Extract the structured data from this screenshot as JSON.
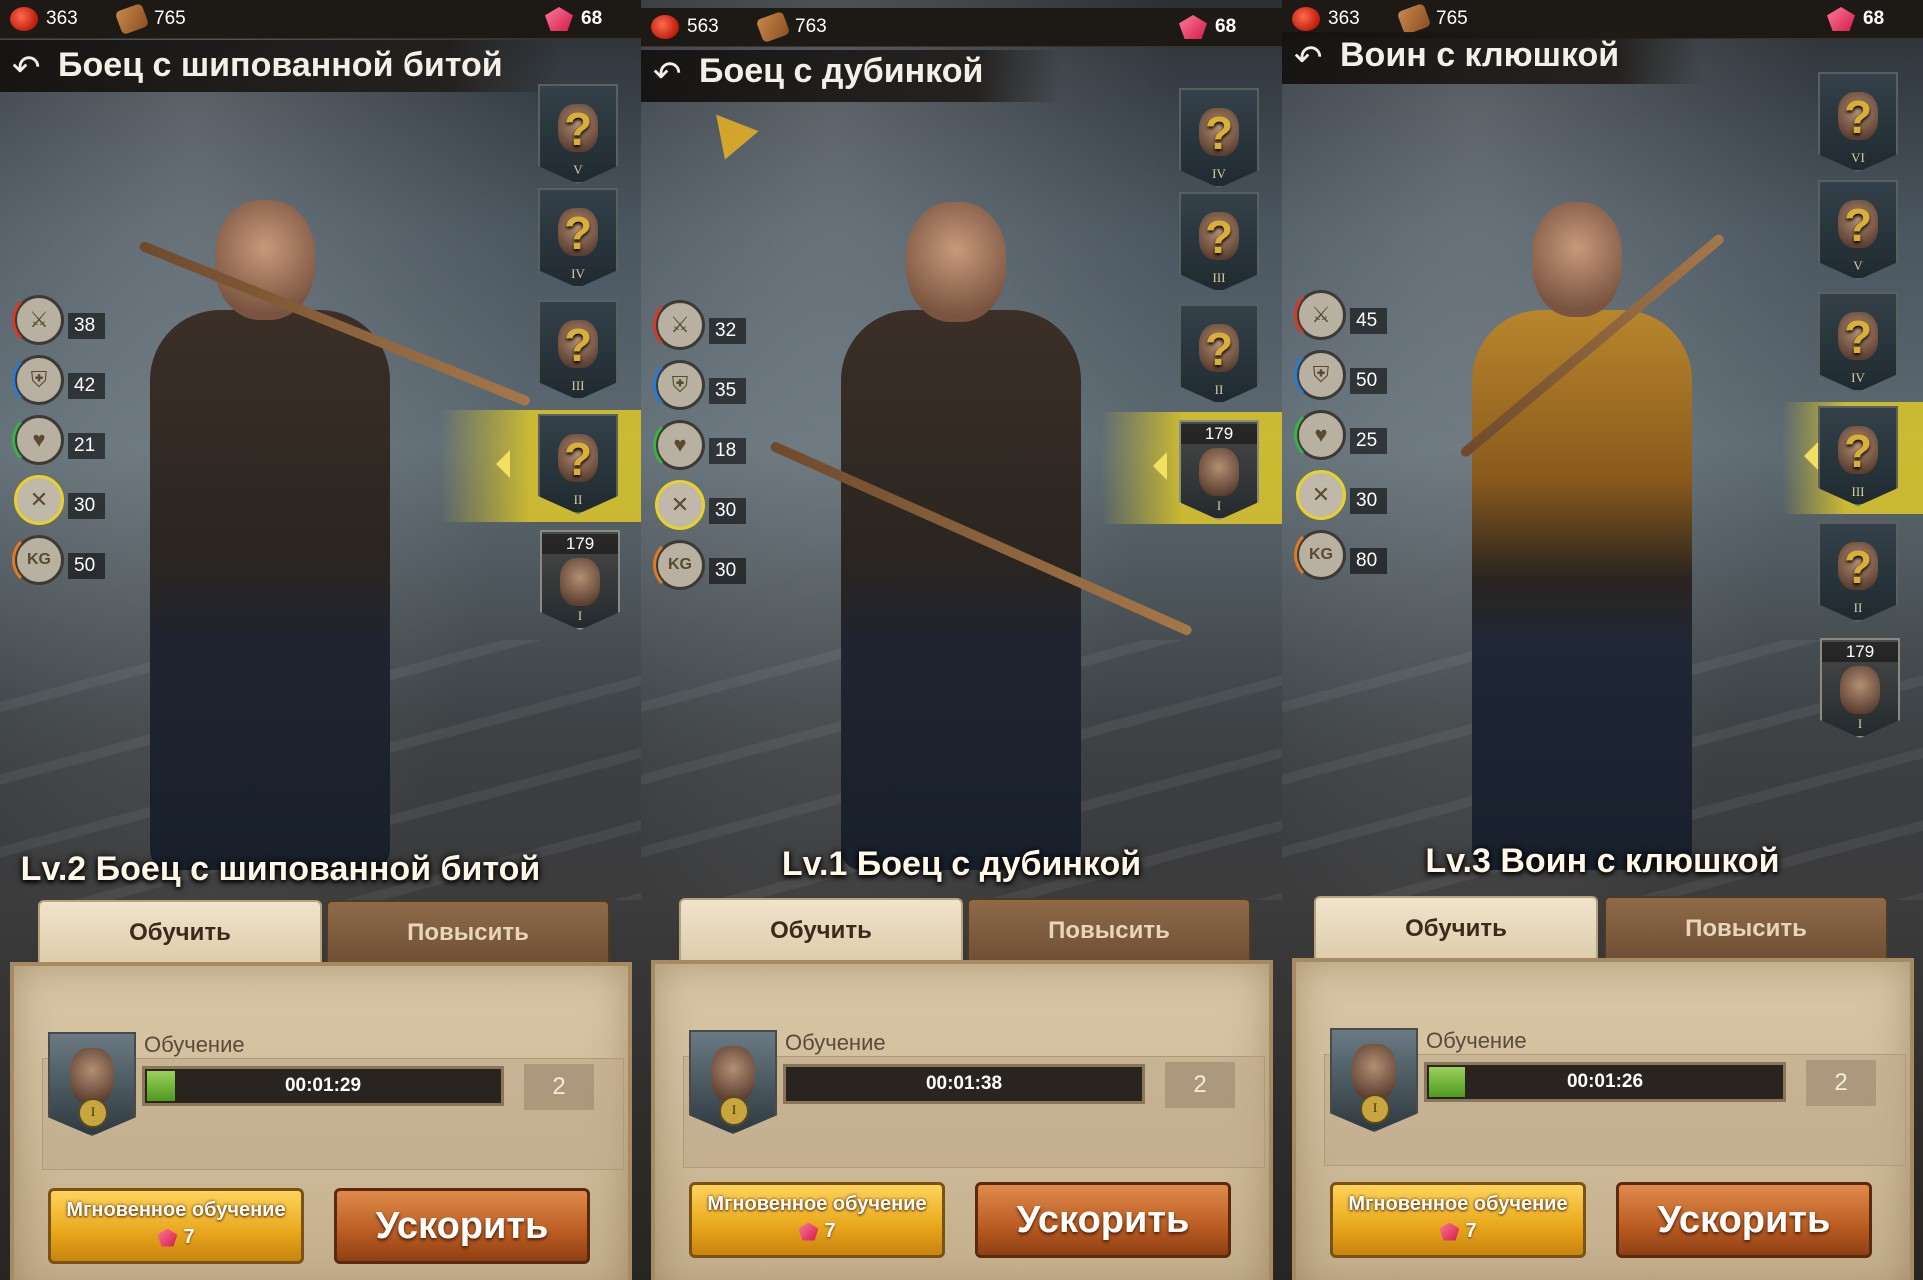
{
  "colors": {
    "accent_gold": "#d9b036",
    "selection": "#dec828",
    "progress_green": "#7cc040",
    "button_orange": "#b95c22",
    "button_yellow": "#e7a61c"
  },
  "panels": [
    {
      "resources": {
        "tomato": "363",
        "wood": "765",
        "gems": "68"
      },
      "title": "Боец с шипованной битой",
      "level_title": "Lv.2 Боец с шипованной битой",
      "stats": [
        {
          "icon": "attack-icon",
          "value": "38"
        },
        {
          "icon": "defense-icon",
          "value": "42"
        },
        {
          "icon": "health-icon",
          "value": "21"
        },
        {
          "icon": "power-icon",
          "value": "30"
        },
        {
          "icon": "load-kg-icon",
          "value": "50"
        }
      ],
      "roster": [
        {
          "tier": "V",
          "locked": true,
          "label": "?"
        },
        {
          "tier": "IV",
          "locked": true,
          "label": "?"
        },
        {
          "tier": "III",
          "locked": true,
          "label": "?"
        },
        {
          "tier": "II",
          "locked": true,
          "label": "?",
          "selected": true
        },
        {
          "tier": "I",
          "locked": false,
          "count": "179"
        }
      ],
      "tabs": {
        "train": "Обучить",
        "upgrade": "Повысить"
      },
      "training": {
        "label": "Обучение",
        "time": "00:01:29",
        "count": "2",
        "progress": 0.08,
        "tier": "I"
      },
      "buttons": {
        "instant": "Мгновенное обучение",
        "instant_cost": "7",
        "speed": "Ускорить"
      }
    },
    {
      "resources": {
        "tomato": "563",
        "wood": "763",
        "gems": "68"
      },
      "title": "Боец с дубинкой",
      "level_title": "Lv.1 Боец с дубинкой",
      "stats": [
        {
          "icon": "attack-icon",
          "value": "32"
        },
        {
          "icon": "defense-icon",
          "value": "35"
        },
        {
          "icon": "health-icon",
          "value": "18"
        },
        {
          "icon": "power-icon",
          "value": "30"
        },
        {
          "icon": "load-kg-icon",
          "value": "30"
        }
      ],
      "roster": [
        {
          "tier": "IV",
          "locked": true,
          "label": "?"
        },
        {
          "tier": "III",
          "locked": true,
          "label": "?"
        },
        {
          "tier": "II",
          "locked": true,
          "label": "?"
        },
        {
          "tier": "I",
          "locked": false,
          "count": "179",
          "selected": true
        }
      ],
      "tabs": {
        "train": "Обучить",
        "upgrade": "Повысить"
      },
      "training": {
        "label": "Обучение",
        "time": "00:01:38",
        "count": "2",
        "progress": 0.0,
        "tier": "I"
      },
      "buttons": {
        "instant": "Мгновенное обучение",
        "instant_cost": "7",
        "speed": "Ускорить"
      }
    },
    {
      "resources": {
        "tomato": "363",
        "wood": "765",
        "gems": "68"
      },
      "title": "Воин с клюшкой",
      "level_title": "Lv.3 Воин с клюшкой",
      "stats": [
        {
          "icon": "attack-icon",
          "value": "45"
        },
        {
          "icon": "defense-icon",
          "value": "50"
        },
        {
          "icon": "health-icon",
          "value": "25"
        },
        {
          "icon": "power-icon",
          "value": "30"
        },
        {
          "icon": "load-kg-icon",
          "value": "80"
        }
      ],
      "roster": [
        {
          "tier": "VI",
          "locked": true,
          "label": "?"
        },
        {
          "tier": "V",
          "locked": true,
          "label": "?"
        },
        {
          "tier": "IV",
          "locked": true,
          "label": "?"
        },
        {
          "tier": "III",
          "locked": true,
          "label": "?",
          "selected": true
        },
        {
          "tier": "II",
          "locked": true,
          "label": "?"
        },
        {
          "tier": "I",
          "locked": false,
          "count": "179"
        }
      ],
      "tabs": {
        "train": "Обучить",
        "upgrade": "Повысить"
      },
      "training": {
        "label": "Обучение",
        "time": "00:01:26",
        "count": "2",
        "progress": 0.1,
        "tier": "I"
      },
      "buttons": {
        "instant": "Мгновенное обучение",
        "instant_cost": "7",
        "speed": "Ускорить"
      }
    }
  ]
}
